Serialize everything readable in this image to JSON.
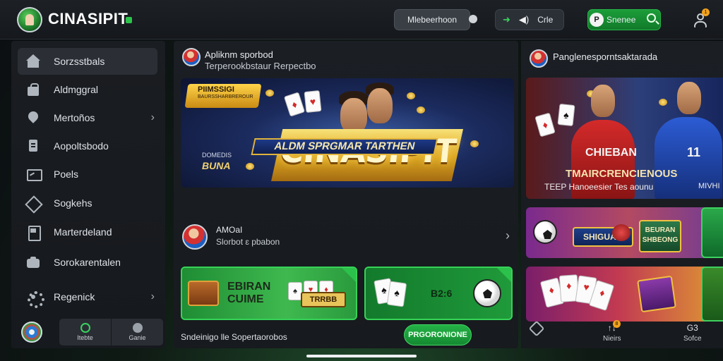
{
  "header": {
    "logo_text": "CINASIPIT",
    "membership_label": "Mlebeerhoon",
    "cast_label": "Crle",
    "search_label": "Snenee",
    "search_badge": "P",
    "notification_count": "1"
  },
  "sidebar": {
    "items": [
      {
        "label": "Sorzsstbals",
        "icon": "home-icon",
        "active": true
      },
      {
        "label": "Aldmggral",
        "icon": "bag-icon"
      },
      {
        "label": "Mertoños",
        "icon": "pin-icon",
        "has_chevron": true
      },
      {
        "label": "Aopoltsbodo",
        "icon": "document-icon"
      },
      {
        "label": "Poels",
        "icon": "screen-icon"
      },
      {
        "label": "Sogkehs",
        "icon": "tag-icon"
      },
      {
        "label": "Marterdeland",
        "icon": "file-icon"
      },
      {
        "label": "Sorokarentalen",
        "icon": "camera-icon"
      },
      {
        "label": "Regenick",
        "icon": "gear-icon",
        "has_chevron": true
      }
    ],
    "footer": {
      "tab_live": "Itebte",
      "tab_other": "Ganie"
    }
  },
  "center": {
    "title": "Apliknm sporbod",
    "subtitle": "Terperookbstaur Rerpectbo",
    "hero": {
      "badge_title": "PIIMSSIGI",
      "badge_sub": "BAURSSHARBREROUR",
      "title": "CINASIPIT",
      "ribbon": "ALDM SPRGMAR TARTHEN",
      "side_small": "DOMEDIS",
      "side_big": "BUNA"
    },
    "promo": {
      "title": "AMOaI",
      "subtitle": "Slorbot ɛ pbabon"
    },
    "tile_left": {
      "label_line1": "EBIRAN",
      "label_line2": "CUIME",
      "slot_label": "TRRBB"
    },
    "tile_right": {
      "label": "B2:6"
    },
    "footer_text": "Sndeinigo lle Sopertaorobos",
    "footer_button": "PRGORONIONE"
  },
  "right": {
    "title": "Panglenesporntsaktarada",
    "card1": {
      "jersey_label": "CHIEBAN",
      "jersey_number": "11",
      "line1": "TMAIRCRENCIENOUS",
      "line2": "TEEP Hanoeesier Tes aounu",
      "tag": "MIVHI"
    },
    "card2": {
      "label_left": "SHIGUAG",
      "label_right": "BEURAN SHBEONG"
    },
    "footer": {
      "item1": "",
      "item2": "Nieirs",
      "item2_badge": "8",
      "item3": "Sofce",
      "item3_top": "G3"
    }
  }
}
